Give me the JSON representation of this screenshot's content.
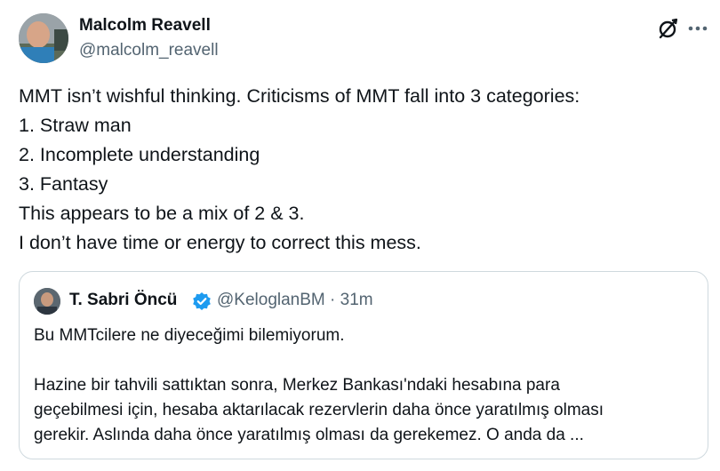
{
  "tweet": {
    "author": {
      "name": "Malcolm Reavell",
      "handle": "@malcolm_reavell"
    },
    "lines": [
      "MMT isn’t wishful thinking. Criticisms of MMT fall into 3 categories:",
      "1. Straw man",
      "2. Incomplete understanding",
      "3. Fantasy",
      "This appears to be a mix of 2 & 3.",
      "I don’t have time or energy to correct this mess."
    ]
  },
  "quote": {
    "author": {
      "name": "T. Sabri Öncü",
      "handle": "@KeloglanBM",
      "separator": "·",
      "time": "31m"
    },
    "paragraph1": "Bu MMTcilere ne diyeceğimi bilemiyorum.",
    "paragraph2": [
      "Hazine bir tahvili sattıktan sonra, Merkez Bankası'ndaki hesabına para",
      "geçebilmesi için, hesaba aktarılacak rezervlerin daha önce yaratılmış olması",
      "gerekir. Aslında daha önce yaratılmış olması da gerekemez. O anda da ..."
    ]
  },
  "icons": {
    "grok": "grok-icon",
    "more": "more-dots-icon",
    "verified": "verified-badge-icon"
  },
  "colors": {
    "text": "#0f1419",
    "secondary": "#536471",
    "border": "#cfd9de",
    "verified": "#1d9bf0"
  }
}
